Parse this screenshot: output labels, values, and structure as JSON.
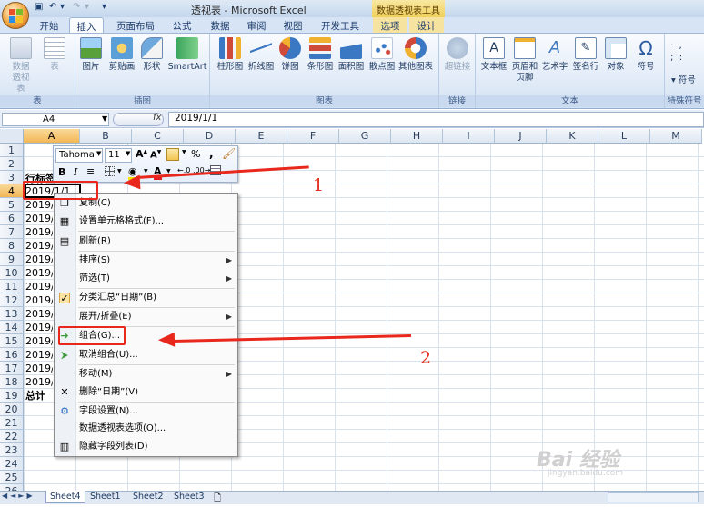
{
  "window": {
    "title": "透视表 - Microsoft Excel",
    "context_tool": "数据透视表工具"
  },
  "tabs": [
    "开始",
    "插入",
    "页面布局",
    "公式",
    "数据",
    "审阅",
    "视图",
    "开发工具",
    "选项",
    "设计"
  ],
  "active_tab": "插入",
  "ribbon": {
    "groups": [
      {
        "label": "表",
        "buttons": [
          "数据透视表",
          "表"
        ]
      },
      {
        "label": "插图",
        "buttons": [
          "图片",
          "剪贴画",
          "形状",
          "SmartArt"
        ]
      },
      {
        "label": "图表",
        "buttons": [
          "柱形图",
          "折线图",
          "饼图",
          "条形图",
          "面积图",
          "散点图",
          "其他图表"
        ]
      },
      {
        "label": "链接",
        "buttons": [
          "超链接"
        ]
      },
      {
        "label": "文本",
        "buttons": [
          "文本框",
          "页眉和页脚",
          "艺术字",
          "签名行",
          "对象",
          "符号"
        ]
      },
      {
        "label": "特殊符号",
        "buttons": [
          "符号"
        ]
      }
    ]
  },
  "formula_bar": {
    "cell_ref": "A4",
    "fx": "fx",
    "value": "2019/1/1"
  },
  "columns": [
    "A",
    "B",
    "C",
    "D",
    "E",
    "F",
    "G",
    "H",
    "I",
    "J",
    "K",
    "L",
    "M"
  ],
  "rows": [
    "1",
    "2",
    "3",
    "4",
    "5",
    "6",
    "7",
    "8",
    "9",
    "10",
    "11",
    "12",
    "13",
    "14",
    "15",
    "16",
    "17",
    "18",
    "19",
    "20",
    "21",
    "22",
    "23",
    "24",
    "25",
    "26"
  ],
  "cells": {
    "a3": "行标签",
    "a4": "2019/1/1",
    "a_dates": [
      "2019/",
      "2019/",
      "2019/",
      "2019/",
      "2019/",
      "2019/",
      "2019/",
      "2019/",
      "2019/",
      "2019/",
      "2019/",
      "2019/",
      "2019/",
      "2019/"
    ],
    "a19": "总计"
  },
  "mini_toolbar": {
    "font": "Tahoma",
    "size": "11",
    "percent": "%",
    "comma": ","
  },
  "context_menu": [
    {
      "label": "复制(C)",
      "icon": "copy-icon"
    },
    {
      "label": "设置单元格格式(F)...",
      "icon": "format-cells-icon"
    },
    {
      "label": "刷新(R)",
      "icon": "refresh-icon"
    },
    {
      "label": "排序(S)",
      "submenu": true
    },
    {
      "label": "筛选(T)",
      "submenu": true
    },
    {
      "label": "分类汇总“日期”(B)",
      "icon": "checkmark-icon"
    },
    {
      "label": "展开/折叠(E)",
      "submenu": true
    },
    {
      "label": "组合(G)...",
      "icon": "group-icon"
    },
    {
      "label": "取消组合(U)...",
      "icon": "ungroup-icon"
    },
    {
      "label": "移动(M)",
      "submenu": true
    },
    {
      "label": "删除“日期”(V)",
      "icon": "delete-x-icon"
    },
    {
      "label": "字段设置(N)...",
      "icon": "field-settings-icon"
    },
    {
      "label": "数据透视表选项(O)...",
      "icon": ""
    },
    {
      "label": "隐藏字段列表(D)",
      "icon": "field-list-icon"
    }
  ],
  "sheets": [
    "Sheet4",
    "Sheet1",
    "Sheet2",
    "Sheet3"
  ],
  "active_sheet": "Sheet4",
  "annotations": {
    "one": "1",
    "two": "2"
  },
  "watermark": {
    "main": "Bai 经验",
    "sub": "jingyan.baidu.com"
  },
  "colors": {
    "accent_red": "#e8281c",
    "ribbon_blue": "#d6e4f5",
    "selected_header": "#f2b755"
  }
}
